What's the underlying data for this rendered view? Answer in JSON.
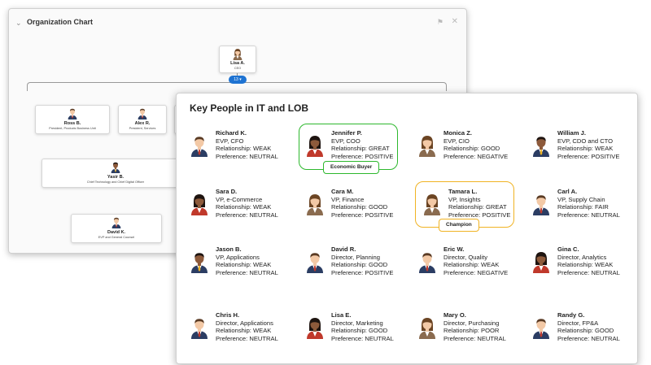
{
  "org_chart": {
    "title": "Organization Chart",
    "badge": "13 ▾",
    "nodes": [
      {
        "name": "Lisa A.",
        "title": "CEO"
      },
      {
        "name": "Ross B.",
        "title": "President, Products Business Unit"
      },
      {
        "name": "Alex R.",
        "title": "President, Services"
      },
      {
        "name": "Yasir B.",
        "title": "Chief Technology and Chief Digital Officer"
      },
      {
        "name": "David K.",
        "title": "EVP and General Counsel"
      }
    ]
  },
  "key_people": {
    "title": "Key People in IT and LOB",
    "people": [
      {
        "name": "Richard K.",
        "title": "EVP, CFO",
        "relationship": "Relationship: WEAK",
        "preference": "Preference: NEUTRAL"
      },
      {
        "name": "Jennifer P.",
        "title": "EVP, COO",
        "relationship": "Relationship: GREAT",
        "preference": "Preference: POSITIVE"
      },
      {
        "name": "Monica Z.",
        "title": "EVP, CIO",
        "relationship": "Relationship: GOOD",
        "preference": "Preference: NEGATIVE"
      },
      {
        "name": "William J.",
        "title": "EVP, CDO and CTO",
        "relationship": "Relationship: WEAK",
        "preference": "Preference: POSITIVE"
      },
      {
        "name": "Sara D.",
        "title": "VP, e-Commerce",
        "relationship": "Relationship: WEAK",
        "preference": "Preference: NEUTRAL"
      },
      {
        "name": "Cara M.",
        "title": "VP, Finance",
        "relationship": "Relationship: GOOD",
        "preference": "Preference: POSITIVE"
      },
      {
        "name": "Tamara L.",
        "title": "VP, Insights",
        "relationship": "Relationship: GREAT",
        "preference": "Preference: POSITIVE"
      },
      {
        "name": "Carl A.",
        "title": "VP, Supply Chain",
        "relationship": "Relationship: FAIR",
        "preference": "Preference: NEUTRAL"
      },
      {
        "name": "Jason B.",
        "title": "VP, Applications",
        "relationship": "Relationship: WEAK",
        "preference": "Preference: NEUTRAL"
      },
      {
        "name": "David R.",
        "title": "Director, Planning",
        "relationship": "Relationship: GOOD",
        "preference": "Preference: POSITIVE"
      },
      {
        "name": "Eric W.",
        "title": "Director, Quality",
        "relationship": "Relationship: WEAK",
        "preference": "Preference: NEGATIVE"
      },
      {
        "name": "Gina C.",
        "title": "Director, Analytics",
        "relationship": "Relationship: WEAK",
        "preference": "Preference: NEUTRAL"
      },
      {
        "name": "Chris H.",
        "title": "Director, Applications",
        "relationship": "Relationship: WEAK",
        "preference": "Preference: NEUTRAL"
      },
      {
        "name": "Lisa E.",
        "title": "Director, Marketing",
        "relationship": "Relationship: GOOD",
        "preference": "Preference: NEUTRAL"
      },
      {
        "name": "Mary O.",
        "title": "Director, Purchasing",
        "relationship": "Relationship: POOR",
        "preference": "Preference: NEUTRAL"
      },
      {
        "name": "Randy G.",
        "title": "Director, FP&A",
        "relationship": "Relationship: GOOD",
        "preference": "Preference: NEUTRAL"
      }
    ],
    "highlights": [
      {
        "person": 1,
        "label": "Economic Buyer",
        "color": "#2db82d"
      },
      {
        "person": 6,
        "label": "Champion",
        "color": "#f0b323"
      }
    ]
  }
}
